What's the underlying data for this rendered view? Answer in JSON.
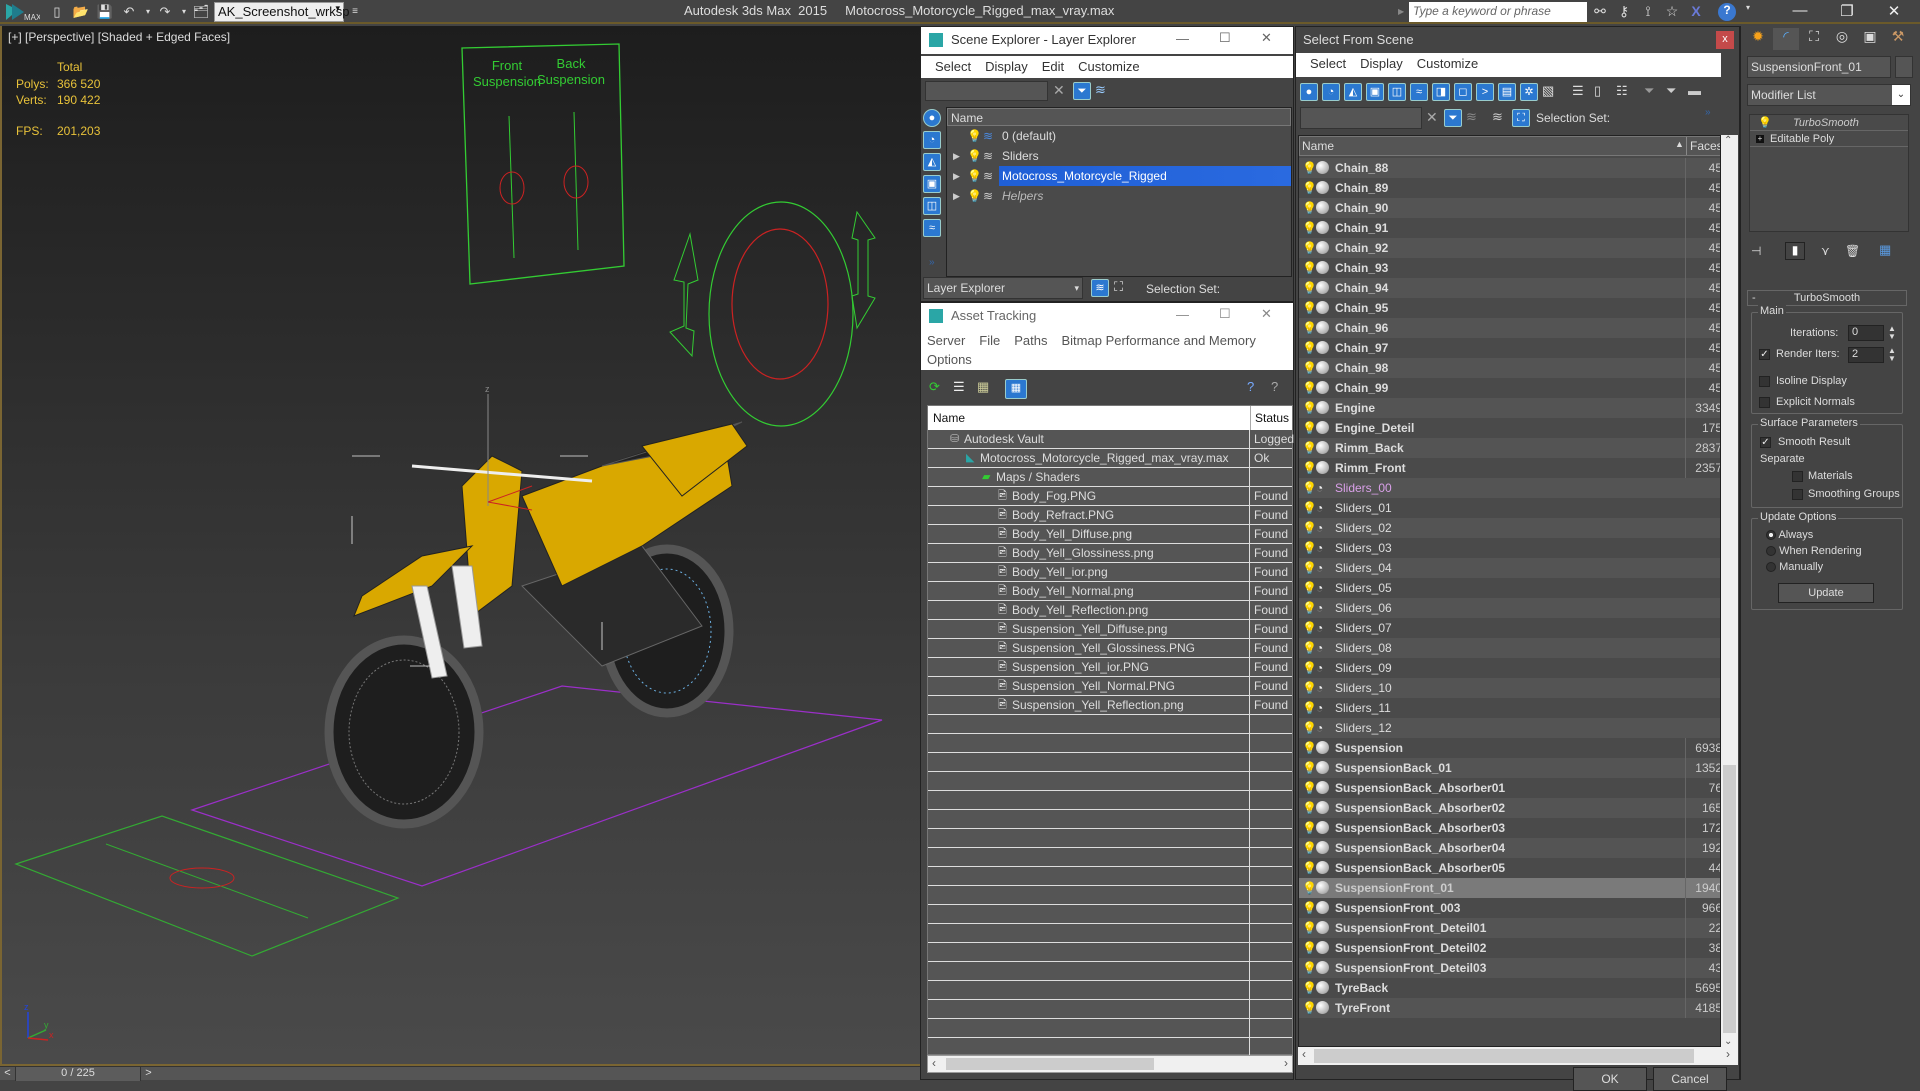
{
  "titlebar": {
    "app_logo": "MAX",
    "workspace": "AK_Screenshot_wrksp",
    "app_title": "Autodesk 3ds Max  2015     Motocross_Motorcycle_Rigged_max_vray.max",
    "search_placeholder": "Type a keyword or phrase"
  },
  "viewport": {
    "label": "[+] [Perspective] [Shaded + Edged Faces]",
    "stats": {
      "total_label": "Total",
      "polys_label": "Polys:",
      "polys_value": "366 520",
      "verts_label": "Verts:",
      "verts_value": "190 422",
      "fps_label": "FPS:",
      "fps_value": "201,203"
    },
    "slider_panel": {
      "front_label": "Front Suspension",
      "back_label": "Back Suspension"
    },
    "axis": {
      "x": "x",
      "y": "y",
      "z": "z"
    }
  },
  "timeline": {
    "prev": "<",
    "frame": "0 / 225",
    "next": ">"
  },
  "scene_explorer": {
    "title": "Scene Explorer - Layer Explorer",
    "menu": [
      "Select",
      "Display",
      "Edit",
      "Customize"
    ],
    "column_name": "Name",
    "layers": [
      {
        "name": "0 (default)",
        "expandable": false,
        "selected": false,
        "italic": false
      },
      {
        "name": "Sliders",
        "expandable": true,
        "selected": false,
        "italic": false
      },
      {
        "name": "Motocross_Motorcycle_Rigged",
        "expandable": true,
        "selected": true,
        "italic": false
      },
      {
        "name": "Helpers",
        "expandable": true,
        "selected": false,
        "italic": true
      }
    ],
    "explorer_type": "Layer Explorer",
    "selection_set_label": "Selection Set:"
  },
  "asset_tracking": {
    "title": "Asset Tracking",
    "menu": [
      "Server",
      "File",
      "Paths",
      "Bitmap Performance and Memory",
      "Options"
    ],
    "columns": [
      "Name",
      "Status"
    ],
    "rows": [
      {
        "name": "Autodesk Vault",
        "status": "Logged",
        "indent": 0,
        "icon": "vault-icon"
      },
      {
        "name": "Motocross_Motorcycle_Rigged_max_vray.max",
        "status": "Ok",
        "indent": 1,
        "icon": "max-file-icon"
      },
      {
        "name": "Maps / Shaders",
        "status": "",
        "indent": 2,
        "icon": "maps-icon"
      },
      {
        "name": "Body_Fog.PNG",
        "status": "Found",
        "indent": 3,
        "icon": "bitmap-icon"
      },
      {
        "name": "Body_Refract.PNG",
        "status": "Found",
        "indent": 3,
        "icon": "bitmap-icon"
      },
      {
        "name": "Body_Yell_Diffuse.png",
        "status": "Found",
        "indent": 3,
        "icon": "bitmap-icon"
      },
      {
        "name": "Body_Yell_Glossiness.png",
        "status": "Found",
        "indent": 3,
        "icon": "bitmap-icon"
      },
      {
        "name": "Body_Yell_ior.png",
        "status": "Found",
        "indent": 3,
        "icon": "bitmap-icon"
      },
      {
        "name": "Body_Yell_Normal.png",
        "status": "Found",
        "indent": 3,
        "icon": "bitmap-icon"
      },
      {
        "name": "Body_Yell_Reflection.png",
        "status": "Found",
        "indent": 3,
        "icon": "bitmap-icon"
      },
      {
        "name": "Suspension_Yell_Diffuse.png",
        "status": "Found",
        "indent": 3,
        "icon": "bitmap-icon"
      },
      {
        "name": "Suspension_Yell_Glossiness.PNG",
        "status": "Found",
        "indent": 3,
        "icon": "bitmap-icon"
      },
      {
        "name": "Suspension_Yell_ior.PNG",
        "status": "Found",
        "indent": 3,
        "icon": "bitmap-icon"
      },
      {
        "name": "Suspension_Yell_Normal.PNG",
        "status": "Found",
        "indent": 3,
        "icon": "bitmap-icon"
      },
      {
        "name": "Suspension_Yell_Reflection.png",
        "status": "Found",
        "indent": 3,
        "icon": "bitmap-icon"
      }
    ]
  },
  "select_from_scene": {
    "title": "Select From Scene",
    "close": "x",
    "menu": [
      "Select",
      "Display",
      "Customize"
    ],
    "selection_set_label": "Selection Set:",
    "columns": [
      "Name",
      "Faces"
    ],
    "objects": [
      {
        "name": "Chain_88",
        "faces": "45",
        "type": "geometry"
      },
      {
        "name": "Chain_89",
        "faces": "45",
        "type": "geometry"
      },
      {
        "name": "Chain_90",
        "faces": "45",
        "type": "geometry"
      },
      {
        "name": "Chain_91",
        "faces": "45",
        "type": "geometry"
      },
      {
        "name": "Chain_92",
        "faces": "45",
        "type": "geometry"
      },
      {
        "name": "Chain_93",
        "faces": "45",
        "type": "geometry"
      },
      {
        "name": "Chain_94",
        "faces": "45",
        "type": "geometry"
      },
      {
        "name": "Chain_95",
        "faces": "45",
        "type": "geometry"
      },
      {
        "name": "Chain_96",
        "faces": "45",
        "type": "geometry"
      },
      {
        "name": "Chain_97",
        "faces": "45",
        "type": "geometry"
      },
      {
        "name": "Chain_98",
        "faces": "45",
        "type": "geometry"
      },
      {
        "name": "Chain_99",
        "faces": "45",
        "type": "geometry"
      },
      {
        "name": "Engine",
        "faces": "3349",
        "type": "geometry"
      },
      {
        "name": "Engine_Deteil",
        "faces": "175",
        "type": "geometry"
      },
      {
        "name": "Rimm_Back",
        "faces": "2837",
        "type": "geometry"
      },
      {
        "name": "Rimm_Front",
        "faces": "2357",
        "type": "geometry"
      },
      {
        "name": "Sliders_00",
        "faces": "",
        "type": "shape",
        "highlight": true
      },
      {
        "name": "Sliders_01",
        "faces": "",
        "type": "shape"
      },
      {
        "name": "Sliders_02",
        "faces": "",
        "type": "shape"
      },
      {
        "name": "Sliders_03",
        "faces": "",
        "type": "shape"
      },
      {
        "name": "Sliders_04",
        "faces": "",
        "type": "shape"
      },
      {
        "name": "Sliders_05",
        "faces": "",
        "type": "shape"
      },
      {
        "name": "Sliders_06",
        "faces": "",
        "type": "shape"
      },
      {
        "name": "Sliders_07",
        "faces": "",
        "type": "shape"
      },
      {
        "name": "Sliders_08",
        "faces": "",
        "type": "shape"
      },
      {
        "name": "Sliders_09",
        "faces": "",
        "type": "shape"
      },
      {
        "name": "Sliders_10",
        "faces": "",
        "type": "shape"
      },
      {
        "name": "Sliders_11",
        "faces": "",
        "type": "shape"
      },
      {
        "name": "Sliders_12",
        "faces": "",
        "type": "shape"
      },
      {
        "name": "Suspension",
        "faces": "6938",
        "type": "geometry"
      },
      {
        "name": "SuspensionBack_01",
        "faces": "1352",
        "type": "geometry"
      },
      {
        "name": "SuspensionBack_Absorber01",
        "faces": "76",
        "type": "geometry"
      },
      {
        "name": "SuspensionBack_Absorber02",
        "faces": "165",
        "type": "geometry"
      },
      {
        "name": "SuspensionBack_Absorber03",
        "faces": "172",
        "type": "geometry"
      },
      {
        "name": "SuspensionBack_Absorber04",
        "faces": "192",
        "type": "geometry"
      },
      {
        "name": "SuspensionBack_Absorber05",
        "faces": "44",
        "type": "geometry"
      },
      {
        "name": "SuspensionFront_01",
        "faces": "1940",
        "type": "geometry",
        "selected": true
      },
      {
        "name": "SuspensionFront_003",
        "faces": "966",
        "type": "geometry"
      },
      {
        "name": "SuspensionFront_Deteil01",
        "faces": "22",
        "type": "geometry"
      },
      {
        "name": "SuspensionFront_Deteil02",
        "faces": "38",
        "type": "geometry"
      },
      {
        "name": "SuspensionFront_Deteil03",
        "faces": "43",
        "type": "geometry"
      },
      {
        "name": "TyreBack",
        "faces": "5695",
        "type": "geometry"
      },
      {
        "name": "TyreFront",
        "faces": "4185",
        "type": "geometry"
      }
    ],
    "ok_label": "OK",
    "cancel_label": "Cancel"
  },
  "command_panel": {
    "object_name": "SuspensionFront_01",
    "modifier_list": "Modifier List",
    "stack": [
      {
        "name": "TurboSmooth",
        "italic": true
      },
      {
        "name": "Editable Poly",
        "italic": false
      }
    ],
    "rollout_title": "TurboSmooth",
    "main_group": "Main",
    "iterations_label": "Iterations:",
    "iterations_value": "0",
    "render_iters_label": "Render Iters:",
    "render_iters_value": "2",
    "render_iters_checked": true,
    "isoline_label": "Isoline Display",
    "isoline_checked": false,
    "explicit_normals_label": "Explicit Normals",
    "explicit_normals_checked": false,
    "surface_group": "Surface Parameters",
    "smooth_result_label": "Smooth Result",
    "smooth_result_checked": true,
    "separate_label": "Separate",
    "materials_label": "Materials",
    "materials_checked": false,
    "smoothing_groups_label": "Smoothing Groups",
    "smoothing_groups_checked": false,
    "update_group": "Update Options",
    "update_options": [
      "Always",
      "When Rendering",
      "Manually"
    ],
    "update_selected": "Always",
    "update_button": "Update"
  },
  "colors": {
    "selection_blue": "#1f5fd6",
    "accent_yellow": "#e8c23a",
    "helper_green": "#33cc33",
    "helper_red": "#cc2222",
    "grid_purple": "#9b2fc9"
  }
}
